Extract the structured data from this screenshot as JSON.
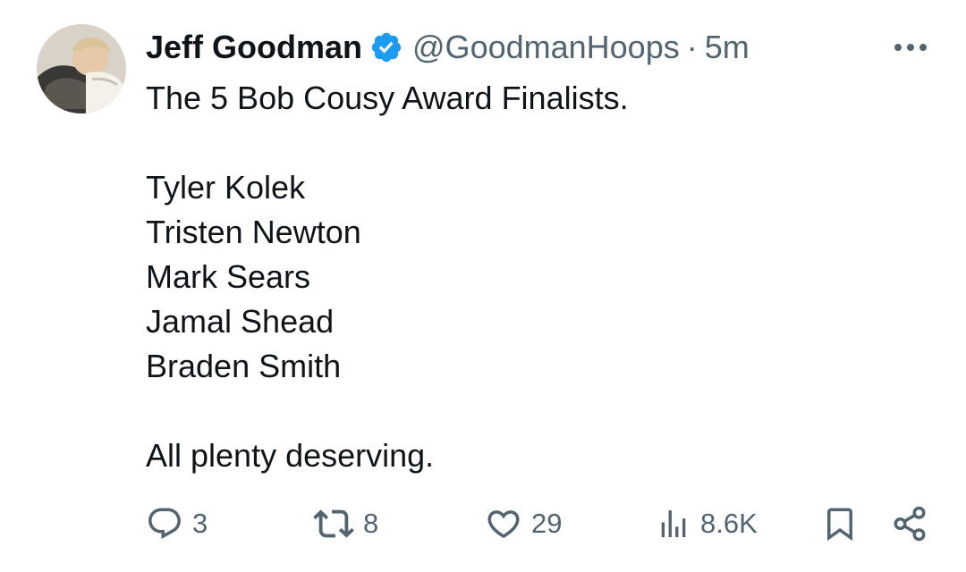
{
  "tweet": {
    "author": {
      "display_name": "Jeff Goodman",
      "handle": "@GoodmanHoops",
      "verified_icon": "verified-badge-icon",
      "avatar_icon": "profile-avatar"
    },
    "separator": "·",
    "time": "5m",
    "more_icon": "more-horizontal-icon",
    "text_lines": [
      "The 5 Bob Cousy Award Finalists.",
      "",
      "Tyler Kolek",
      "Tristen Newton",
      "Mark Sears",
      "Jamal Shead",
      "Braden Smith",
      "",
      "All plenty deserving."
    ],
    "actions": {
      "reply": {
        "icon": "reply-icon",
        "count": "3"
      },
      "retweet": {
        "icon": "retweet-icon",
        "count": "8"
      },
      "like": {
        "icon": "heart-icon",
        "count": "29"
      },
      "views": {
        "icon": "views-icon",
        "count": "8.6K"
      },
      "bookmark": {
        "icon": "bookmark-icon"
      },
      "share": {
        "icon": "share-icon"
      }
    }
  },
  "colors": {
    "text_primary": "#0f1419",
    "text_secondary": "#536471",
    "verified_blue": "#1d9bf0"
  }
}
